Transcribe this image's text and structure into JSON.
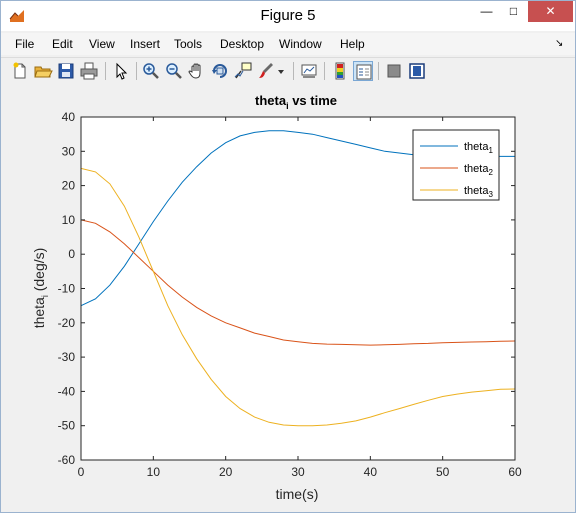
{
  "window": {
    "title": "Figure 5",
    "minimize": "—",
    "maximize": "□",
    "close": "✕"
  },
  "menu": [
    "File",
    "Edit",
    "View",
    "Insert",
    "Tools",
    "Desktop",
    "Window",
    "Help"
  ],
  "toolbar": [
    "new-figure",
    "open-file",
    "save",
    "print",
    "edit-plot",
    "zoom-in",
    "zoom-out",
    "pan",
    "rotate-3d",
    "data-cursor",
    "brush",
    "brush-dropdown",
    "link-plot",
    "insert-colorbar",
    "insert-legend",
    "hide-plot-tools",
    "show-plot-tools"
  ],
  "chart_data": {
    "type": "line",
    "title_main": "theta",
    "title_sub": "i",
    "title_rest": " vs time",
    "xlabel": "time(s)",
    "ylabel_main": "theta",
    "ylabel_sub": "i",
    "ylabel_rest": " (deg/s)",
    "xlim": [
      0,
      60
    ],
    "ylim": [
      -60,
      40
    ],
    "xticks": [
      0,
      10,
      20,
      30,
      40,
      50,
      60
    ],
    "yticks": [
      -60,
      -50,
      -40,
      -30,
      -20,
      -10,
      0,
      10,
      20,
      30,
      40
    ],
    "grid": false,
    "legend_position": "top-right",
    "series": [
      {
        "name": "theta",
        "sub": "1",
        "color": "#0072bd",
        "x": [
          0,
          2,
          4,
          6,
          8,
          10,
          12,
          14,
          16,
          18,
          20,
          22,
          24,
          26,
          28,
          30,
          32,
          34,
          36,
          38,
          40,
          42,
          44,
          46,
          48,
          50,
          52,
          54,
          56,
          58,
          60
        ],
        "y": [
          -15,
          -13,
          -9,
          -3.5,
          3,
          9.5,
          15.5,
          21,
          25.5,
          29.5,
          32.5,
          34.5,
          35.5,
          36,
          36,
          35.5,
          35,
          34,
          33,
          32,
          31,
          30,
          29.5,
          29,
          28.5,
          28.5,
          28.5,
          28.5,
          28.5,
          28.5,
          28.5
        ]
      },
      {
        "name": "theta",
        "sub": "2",
        "color": "#d95319",
        "x": [
          0,
          2,
          4,
          6,
          8,
          10,
          12,
          14,
          16,
          18,
          20,
          22,
          24,
          26,
          28,
          30,
          32,
          34,
          36,
          38,
          40,
          42,
          44,
          46,
          48,
          50,
          52,
          54,
          56,
          58,
          60
        ],
        "y": [
          10,
          9,
          6.5,
          3,
          -1,
          -5,
          -9,
          -12.5,
          -15.5,
          -18,
          -20,
          -21.5,
          -23,
          -24,
          -25,
          -25.5,
          -26,
          -26.2,
          -26.3,
          -26.4,
          -26.5,
          -26.4,
          -26.3,
          -26.1,
          -26,
          -25.8,
          -25.7,
          -25.6,
          -25.5,
          -25.4,
          -25.3
        ]
      },
      {
        "name": "theta",
        "sub": "3",
        "color": "#edb120",
        "x": [
          0,
          2,
          4,
          6,
          8,
          10,
          12,
          14,
          16,
          18,
          20,
          22,
          24,
          26,
          28,
          30,
          32,
          34,
          36,
          38,
          40,
          42,
          44,
          46,
          48,
          50,
          52,
          54,
          56,
          58,
          60
        ],
        "y": [
          25,
          24,
          20.5,
          14,
          5,
          -5,
          -15,
          -23.5,
          -30.5,
          -36.5,
          -41.5,
          -45,
          -47.5,
          -49,
          -49.8,
          -50,
          -50,
          -49.8,
          -49.3,
          -48.6,
          -47.5,
          -46.2,
          -45,
          -43.8,
          -42.6,
          -41.5,
          -40.8,
          -40.2,
          -39.8,
          -39.4,
          -39.3
        ]
      }
    ]
  }
}
